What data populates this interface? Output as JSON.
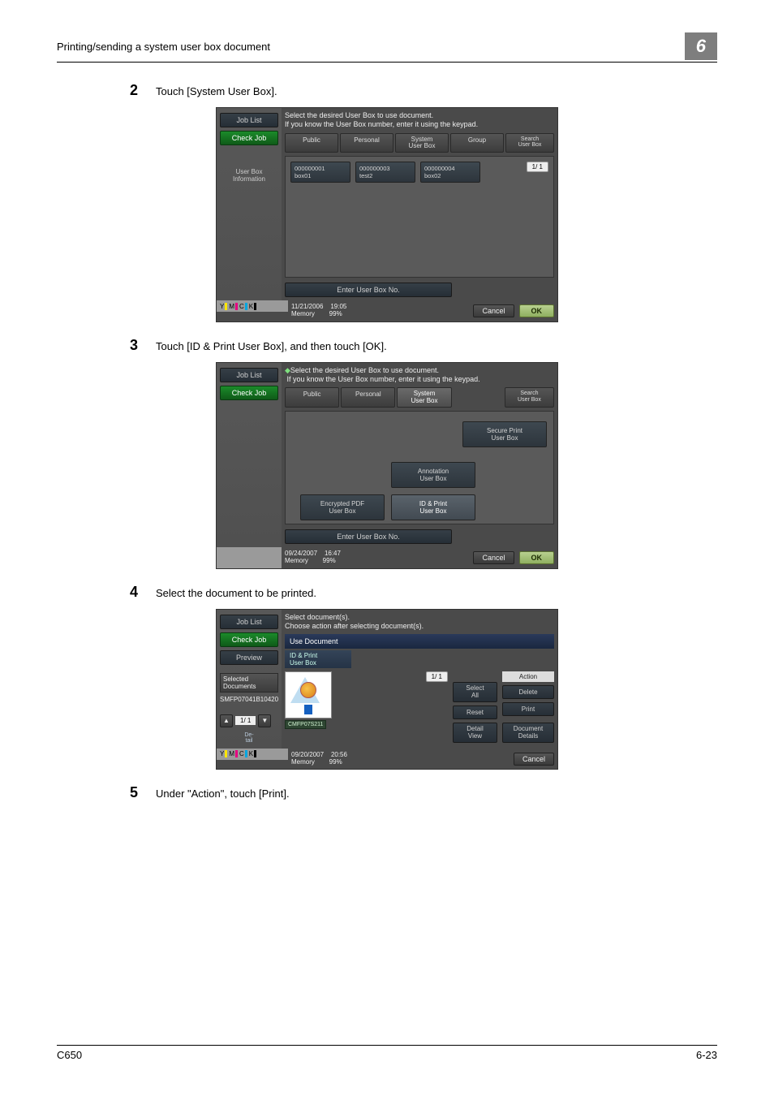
{
  "header": {
    "left": "Printing/sending a system user box document",
    "right": "6"
  },
  "steps": {
    "s2": {
      "num": "2",
      "text": "Touch [System User Box]."
    },
    "s3": {
      "num": "3",
      "text": "Touch [ID & Print User Box], and then touch [OK]."
    },
    "s4": {
      "num": "4",
      "text": "Select the document to be printed."
    },
    "s5": {
      "num": "5",
      "text": "Under \"Action\", touch [Print]."
    }
  },
  "shot1": {
    "jobList": "Job List",
    "checkJob": "Check Job",
    "userBoxInfo": "User Box\nInformation",
    "hint1": "Select the desired User Box to use document.",
    "hint2": "If you know the User Box number, enter it using the keypad.",
    "tabs": {
      "public": "Public",
      "personal": "Personal",
      "system": "System\nUser Box",
      "group": "Group",
      "search": "Search\nUser Box"
    },
    "boxes": [
      {
        "id": "000000001",
        "name": "box01"
      },
      {
        "id": "000000003",
        "name": "test2"
      },
      {
        "id": "000000004",
        "name": "box02"
      }
    ],
    "pager": "1/  1",
    "enter": "Enter User Box No.",
    "date": "11/21/2006",
    "time": "19:05",
    "memory": "Memory",
    "memval": "99%",
    "cancel": "Cancel",
    "ok": "OK"
  },
  "shot2": {
    "jobList": "Job List",
    "checkJob": "Check Job",
    "hint1": "Select the desired User Box to use document.",
    "hint2": "If you know the User Box number, enter it using the keypad.",
    "tabs": {
      "public": "Public",
      "personal": "Personal",
      "system": "System\nUser Box",
      "search": "Search\nUser Box"
    },
    "boxes": {
      "secure": "Secure Print\nUser Box",
      "annot": "Annotation\nUser Box",
      "encpdf": "Encrypted PDF\nUser Box",
      "idprint": "ID & Print\nUser Box"
    },
    "enter": "Enter User Box No.",
    "date": "09/24/2007",
    "time": "16:47",
    "memory": "Memory",
    "memval": "99%",
    "cancel": "Cancel",
    "ok": "OK"
  },
  "shot3": {
    "jobList": "Job List",
    "checkJob": "Check Job",
    "preview": "Preview",
    "selDocs": "Selected Documents",
    "docId": "SMFP07041B10420",
    "hint1": "Select document(s).",
    "hint2": "Choose action after selecting document(s).",
    "useDoc": "Use Document",
    "subTab": "ID & Print\nUser Box",
    "thumbName": "CMFP07S211",
    "pager": "1/  1",
    "selectAll": "Select\nAll",
    "reset": "Reset",
    "detailView": "Detail\nView",
    "action": "Action",
    "delete": "Delete",
    "print": "Print",
    "docDetails": "Document\nDetails",
    "leftPager": "1/  1",
    "del": "De-\ntail",
    "date": "09/20/2007",
    "time": "20:56",
    "memory": "Memory",
    "memval": "99%",
    "cancel": "Cancel"
  },
  "footer": {
    "left": "C650",
    "right": "6-23"
  },
  "ink": {
    "y": "Y",
    "m": "M",
    "c": "C",
    "k": "K"
  }
}
